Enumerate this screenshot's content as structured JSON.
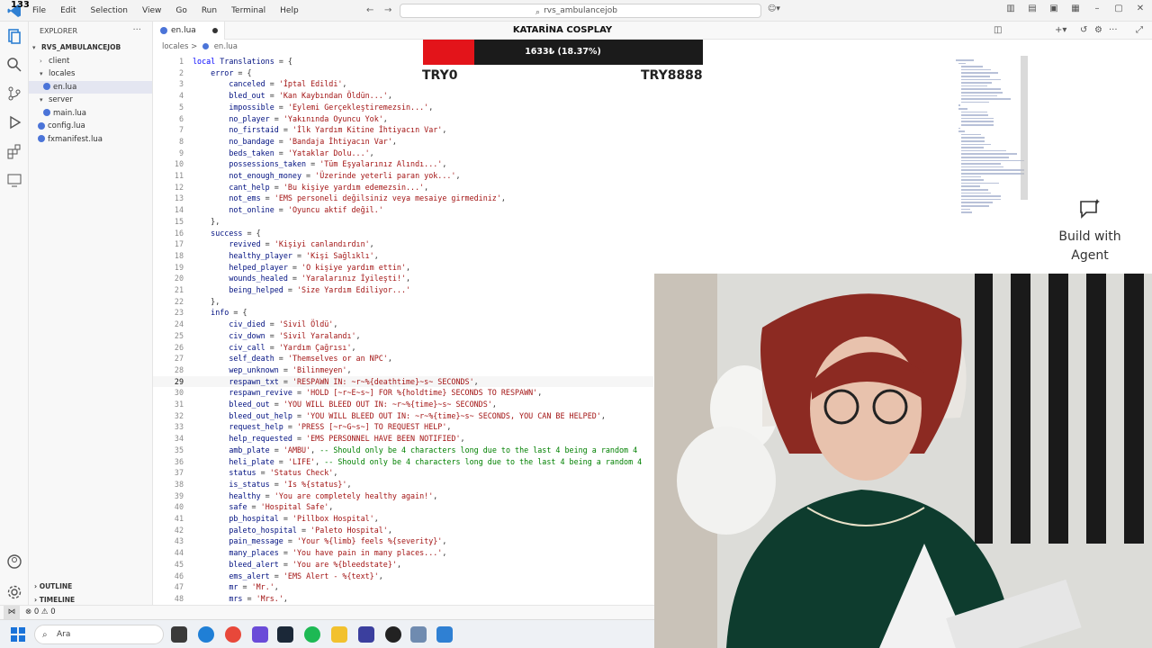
{
  "titlebar": {
    "notification_count": "133",
    "menu": [
      "File",
      "Edit",
      "Selection",
      "View",
      "Go",
      "Run",
      "Terminal",
      "Help"
    ],
    "search": "rvs_ambulancejob"
  },
  "explorer": {
    "title": "EXPLORER",
    "root": "RVS_AMBULANCEJOB",
    "items": [
      {
        "label": "client",
        "type": "folder",
        "depth": 1,
        "open": false
      },
      {
        "label": "locales",
        "type": "folder",
        "depth": 1,
        "open": true
      },
      {
        "label": "en.lua",
        "type": "file",
        "depth": 2,
        "selected": true
      },
      {
        "label": "server",
        "type": "folder",
        "depth": 1,
        "open": true
      },
      {
        "label": "main.lua",
        "type": "file",
        "depth": 2
      },
      {
        "label": "config.lua",
        "type": "file",
        "depth": 1
      },
      {
        "label": "fxmanifest.lua",
        "type": "file",
        "depth": 1
      }
    ],
    "outline": "OUTLINE",
    "timeline": "TIMELINE"
  },
  "tab": {
    "label": "en.lua"
  },
  "breadcrumb": {
    "folder": "locales",
    "sep": ">",
    "file": "en.lua"
  },
  "status": {
    "text": "⊗ 0 ⚠ 0"
  },
  "code_lines": [
    [
      [
        "k",
        "local "
      ],
      [
        "v",
        "Translations"
      ],
      [
        "p",
        " = {"
      ]
    ],
    [
      [
        "v",
        "    error"
      ],
      [
        "p",
        " = {"
      ]
    ],
    [
      [
        "v",
        "        canceled"
      ],
      [
        "p",
        " = "
      ],
      [
        "s",
        "'İptal Edildi'"
      ],
      [
        "p",
        ","
      ]
    ],
    [
      [
        "v",
        "        bled_out"
      ],
      [
        "p",
        " = "
      ],
      [
        "s",
        "'Kan Kaybından Öldün...'"
      ],
      [
        "p",
        ","
      ]
    ],
    [
      [
        "v",
        "        impossible"
      ],
      [
        "p",
        " = "
      ],
      [
        "s",
        "'Eylemi Gerçekleştiremezsin...'"
      ],
      [
        "p",
        ","
      ]
    ],
    [
      [
        "v",
        "        no_player"
      ],
      [
        "p",
        " = "
      ],
      [
        "s",
        "'Yakınında Oyuncu Yok'"
      ],
      [
        "p",
        ","
      ]
    ],
    [
      [
        "v",
        "        no_firstaid"
      ],
      [
        "p",
        " = "
      ],
      [
        "s",
        "'İlk Yardım Kitine İhtiyacın Var'"
      ],
      [
        "p",
        ","
      ]
    ],
    [
      [
        "v",
        "        no_bandage"
      ],
      [
        "p",
        " = "
      ],
      [
        "s",
        "'Bandaja İhtiyacın Var'"
      ],
      [
        "p",
        ","
      ]
    ],
    [
      [
        "v",
        "        beds_taken"
      ],
      [
        "p",
        " = "
      ],
      [
        "s",
        "'Yataklar Dolu...'"
      ],
      [
        "p",
        ","
      ]
    ],
    [
      [
        "v",
        "        possessions_taken"
      ],
      [
        "p",
        " = "
      ],
      [
        "s",
        "'Tüm Eşyalarınız Alındı...'"
      ],
      [
        "p",
        ","
      ]
    ],
    [
      [
        "v",
        "        not_enough_money"
      ],
      [
        "p",
        " = "
      ],
      [
        "s",
        "'Üzerinde yeterli paran yok...'"
      ],
      [
        "p",
        ","
      ]
    ],
    [
      [
        "v",
        "        cant_help"
      ],
      [
        "p",
        " = "
      ],
      [
        "s",
        "'Bu kişiye yardım edemezsin...'"
      ],
      [
        "p",
        ","
      ]
    ],
    [
      [
        "v",
        "        not_ems"
      ],
      [
        "p",
        " = "
      ],
      [
        "s",
        "'EMS personeli değilsiniz veya mesaiye girmediniz'"
      ],
      [
        "p",
        ","
      ]
    ],
    [
      [
        "v",
        "        not_online"
      ],
      [
        "p",
        " = "
      ],
      [
        "s",
        "'Oyuncu aktif değil.'"
      ]
    ],
    [
      [
        "p",
        "    },"
      ]
    ],
    [
      [
        "v",
        "    success"
      ],
      [
        "p",
        " = {"
      ]
    ],
    [
      [
        "v",
        "        revived"
      ],
      [
        "p",
        " = "
      ],
      [
        "s",
        "'Kişiyi canlandırdın'"
      ],
      [
        "p",
        ","
      ]
    ],
    [
      [
        "v",
        "        healthy_player"
      ],
      [
        "p",
        " = "
      ],
      [
        "s",
        "'Kişi Sağlıklı'"
      ],
      [
        "p",
        ","
      ]
    ],
    [
      [
        "v",
        "        helped_player"
      ],
      [
        "p",
        " = "
      ],
      [
        "s",
        "'O kişiye yardım ettin'"
      ],
      [
        "p",
        ","
      ]
    ],
    [
      [
        "v",
        "        wounds_healed"
      ],
      [
        "p",
        " = "
      ],
      [
        "s",
        "'Yaralarınız İyileşti!'"
      ],
      [
        "p",
        ","
      ]
    ],
    [
      [
        "v",
        "        being_helped"
      ],
      [
        "p",
        " = "
      ],
      [
        "s",
        "'Size Yardım Ediliyor...'"
      ]
    ],
    [
      [
        "p",
        "    },"
      ]
    ],
    [
      [
        "v",
        "    info"
      ],
      [
        "p",
        " = {"
      ]
    ],
    [
      [
        "v",
        "        civ_died"
      ],
      [
        "p",
        " = "
      ],
      [
        "s",
        "'Sivil Öldü'"
      ],
      [
        "p",
        ","
      ]
    ],
    [
      [
        "v",
        "        civ_down"
      ],
      [
        "p",
        " = "
      ],
      [
        "s",
        "'Sivil Yaralandı'"
      ],
      [
        "p",
        ","
      ]
    ],
    [
      [
        "v",
        "        civ_call"
      ],
      [
        "p",
        " = "
      ],
      [
        "s",
        "'Yardım Çağrısı'"
      ],
      [
        "p",
        ","
      ]
    ],
    [
      [
        "v",
        "        self_death"
      ],
      [
        "p",
        " = "
      ],
      [
        "s",
        "'Themselves or an NPC'"
      ],
      [
        "p",
        ","
      ]
    ],
    [
      [
        "v",
        "        wep_unknown"
      ],
      [
        "p",
        " = "
      ],
      [
        "s",
        "'Bilinmeyen'"
      ],
      [
        "p",
        ","
      ]
    ],
    [
      [
        "v",
        "        respawn_txt"
      ],
      [
        "p",
        " = "
      ],
      [
        "s",
        "'RESPAWN IN: ~r~%{deathtime}~s~ SECONDS'"
      ],
      [
        "p",
        ","
      ]
    ],
    [
      [
        "v",
        "        respawn_revive"
      ],
      [
        "p",
        " = "
      ],
      [
        "s",
        "'HOLD [~r~E~s~] FOR %{holdtime} SECONDS TO RESPAWN'"
      ],
      [
        "p",
        ","
      ]
    ],
    [
      [
        "v",
        "        bleed_out"
      ],
      [
        "p",
        " = "
      ],
      [
        "s",
        "'YOU WILL BLEED OUT IN: ~r~%{time}~s~ SECONDS'"
      ],
      [
        "p",
        ","
      ]
    ],
    [
      [
        "v",
        "        bleed_out_help"
      ],
      [
        "p",
        " = "
      ],
      [
        "s",
        "'YOU WILL BLEED OUT IN: ~r~%{time}~s~ SECONDS, YOU CAN BE HELPED'"
      ],
      [
        "p",
        ","
      ]
    ],
    [
      [
        "v",
        "        request_help"
      ],
      [
        "p",
        " = "
      ],
      [
        "s",
        "'PRESS [~r~G~s~] TO REQUEST HELP'"
      ],
      [
        "p",
        ","
      ]
    ],
    [
      [
        "v",
        "        help_requested"
      ],
      [
        "p",
        " = "
      ],
      [
        "s",
        "'EMS PERSONNEL HAVE BEEN NOTIFIED'"
      ],
      [
        "p",
        ","
      ]
    ],
    [
      [
        "v",
        "        amb_plate"
      ],
      [
        "p",
        " = "
      ],
      [
        "s",
        "'AMBU'"
      ],
      [
        "p",
        ", "
      ],
      [
        "c",
        "-- Should only be 4 characters long due to the last 4 being a random 4"
      ]
    ],
    [
      [
        "v",
        "        heli_plate"
      ],
      [
        "p",
        " = "
      ],
      [
        "s",
        "'LIFE'"
      ],
      [
        "p",
        ", "
      ],
      [
        "c",
        "-- Should only be 4 characters long due to the last 4 being a random 4"
      ]
    ],
    [
      [
        "v",
        "        status"
      ],
      [
        "p",
        " = "
      ],
      [
        "s",
        "'Status Check'"
      ],
      [
        "p",
        ","
      ]
    ],
    [
      [
        "v",
        "        is_status"
      ],
      [
        "p",
        " = "
      ],
      [
        "s",
        "'Is %{status}'"
      ],
      [
        "p",
        ","
      ]
    ],
    [
      [
        "v",
        "        healthy"
      ],
      [
        "p",
        " = "
      ],
      [
        "s",
        "'You are completely healthy again!'"
      ],
      [
        "p",
        ","
      ]
    ],
    [
      [
        "v",
        "        safe"
      ],
      [
        "p",
        " = "
      ],
      [
        "s",
        "'Hospital Safe'"
      ],
      [
        "p",
        ","
      ]
    ],
    [
      [
        "v",
        "        pb_hospital"
      ],
      [
        "p",
        " = "
      ],
      [
        "s",
        "'Pillbox Hospital'"
      ],
      [
        "p",
        ","
      ]
    ],
    [
      [
        "v",
        "        paleto_hospital"
      ],
      [
        "p",
        " = "
      ],
      [
        "s",
        "'Paleto Hospital'"
      ],
      [
        "p",
        ","
      ]
    ],
    [
      [
        "v",
        "        pain_message"
      ],
      [
        "p",
        " = "
      ],
      [
        "s",
        "'Your %{limb} feels %{severity}'"
      ],
      [
        "p",
        ","
      ]
    ],
    [
      [
        "v",
        "        many_places"
      ],
      [
        "p",
        " = "
      ],
      [
        "s",
        "'You have pain in many places...'"
      ],
      [
        "p",
        ","
      ]
    ],
    [
      [
        "v",
        "        bleed_alert"
      ],
      [
        "p",
        " = "
      ],
      [
        "s",
        "'You are %{bleedstate}'"
      ],
      [
        "p",
        ","
      ]
    ],
    [
      [
        "v",
        "        ems_alert"
      ],
      [
        "p",
        " = "
      ],
      [
        "s",
        "'EMS Alert - %{text}'"
      ],
      [
        "p",
        ","
      ]
    ],
    [
      [
        "v",
        "        mr"
      ],
      [
        "p",
        " = "
      ],
      [
        "s",
        "'Mr.'"
      ],
      [
        "p",
        ","
      ]
    ],
    [
      [
        "v",
        "        mrs"
      ],
      [
        "p",
        " = "
      ],
      [
        "s",
        "'Mrs.'"
      ],
      [
        "p",
        ","
      ]
    ]
  ],
  "current_line": 29,
  "stream_overlay": {
    "title": "KATARİNA COSPLAY",
    "goal_text": "1633₺ (18.37%)",
    "goal_fraction": 0.1837,
    "left_label": "TRY0",
    "right_label": "TRY8888"
  },
  "agent_panel": {
    "line1": "Build with",
    "line2": "Agent"
  },
  "taskbar": {
    "search_placeholder": "Ara"
  },
  "colors": {
    "accent": "#4b74d8",
    "goal_fill": "#e3141a",
    "goal_bg": "#1b1b1b"
  }
}
